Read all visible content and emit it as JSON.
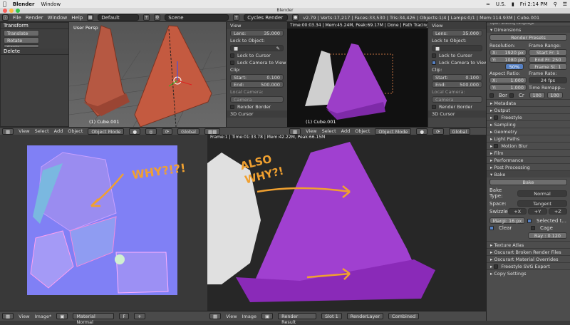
{
  "menubar": {
    "app": "Blender",
    "items": [
      "Window"
    ],
    "clock": "Fri 2:14 PM",
    "locale": "U.S."
  },
  "window_title": "Blender",
  "info": {
    "menus": [
      "File",
      "Render",
      "Window",
      "Help"
    ],
    "layout": "Default",
    "scene": "Scene",
    "engine": "Cycles Render",
    "stats": "v2.79 | Verts:17,217 | Faces:33,530 | Tris:34,426 | Objects:1/4 | Lamps:0/1 | Mem:114.93M | Cube.001"
  },
  "tool_shelf": {
    "header": "Transform",
    "buttons": [
      "Translate",
      "Rotate",
      "Scale"
    ],
    "delete": "Delete"
  },
  "viewport_left": {
    "corner": "User Persp",
    "object_label": "(1) Cube.001"
  },
  "viewport_right": {
    "status": "Time:00:03.34 | Mem:45.24M, Peak:69.17M | Done | Path Tracing Sample",
    "object_label": "(1) Cube.001"
  },
  "npanel_left": {
    "view": "View",
    "lens_label": "Lens:",
    "lens_value": "35.000",
    "lock_obj": "Lock to Object:",
    "lock_cursor": "Lock to Cursor",
    "lock_cam": "Lock Camera to View",
    "clip": "Clip:",
    "start_label": "Start:",
    "start_value": "0.100",
    "end_label": "End:",
    "end_value": "500.000",
    "local_cam": "Local Camera:",
    "camera": "Camera",
    "render_border": "Render Border",
    "cursor": "3D Cursor"
  },
  "npanel_right": {
    "view": "View",
    "lens_label": "Lens:",
    "lens_value": "35.000",
    "lock_obj": "Lock to Object:",
    "lock_cursor": "Lock to Cursor",
    "lock_cam": "Lock Camera to View",
    "clip": "Clip:",
    "start_label": "Start:",
    "start_value": "0.100",
    "end_label": "End:",
    "end_value": "500.000",
    "local_cam": "Local Camera:",
    "camera": "Camera",
    "render_border": "Render Border",
    "cursor": "3D Cursor"
  },
  "viewport_header": {
    "menus": [
      "View",
      "Select",
      "Add",
      "Object"
    ],
    "mode": "Object Mode",
    "orientation": "Global"
  },
  "image_left": {
    "annotation": "WHY?!?!",
    "status": ""
  },
  "image_right": {
    "status": "Frame:1 | Time:01:33.78 | Mem:42.22M, Peak:66.15M",
    "annotation_line1": "ALSO",
    "annotation_line2": "WHY?!"
  },
  "image_header_left": {
    "menus": [
      "View",
      "Image*"
    ],
    "image": "Material Normal"
  },
  "image_header_right": {
    "menus": [
      "View",
      "Image"
    ],
    "image": "Render Result",
    "slot": "Slot 1",
    "layer": "RenderLayer",
    "pass": "Combined"
  },
  "properties": {
    "top_cut": "Open Shading Language",
    "dimensions": "Dimensions",
    "presets": "Render Presets",
    "resolution": "Resolution:",
    "res_x": "1920 px",
    "res_y": "1080 px",
    "res_pct": "50%",
    "frame_range": "Frame Range:",
    "start_frame": "Start Fr: 1",
    "end_frame": "End Fr: 250",
    "frame_step": "Frame St: 1",
    "aspect": "Aspect Ratio:",
    "asp_x": "1.000",
    "asp_y": "1.000",
    "frame_rate": "Frame Rate:",
    "fps": "24 fps",
    "time_remap": "Time Remapp...",
    "remap_old": "100",
    "remap_new": "100",
    "bor": "Bor",
    "cr": "Cr",
    "sections": [
      "Metadata",
      "Output",
      "Freestyle",
      "Sampling",
      "Geometry",
      "Light Paths",
      "Motion Blur",
      "Film",
      "Performance",
      "Post Processing"
    ],
    "bake": "Bake",
    "bake_btn": "Bake",
    "bake_type_label": "Bake Type:",
    "bake_type": "Normal",
    "space_label": "Space:",
    "space": "Tangent",
    "swizzle_label": "Swizzle:",
    "swizzle": [
      "+X",
      "+Y",
      "+Z"
    ],
    "margin": "Margi: 16 px",
    "selected": "Selected t...",
    "clear": "Clear",
    "cage": "Cage",
    "ray": "Ray : 0.120",
    "bottom_sections": [
      "Texture Atlas",
      "Oscurart Broken Render Files",
      "Oscurart Material Overrides",
      "Freestyle SVG Export",
      "Copy Settings"
    ]
  }
}
